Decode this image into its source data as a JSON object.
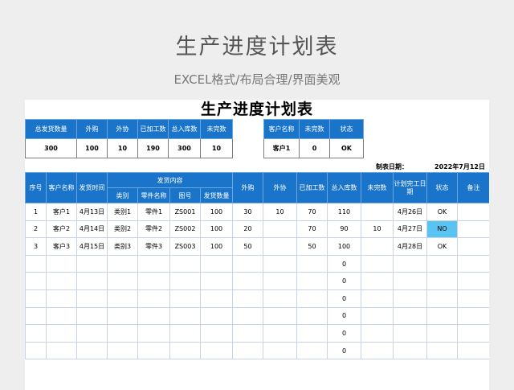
{
  "page": {
    "title": "生产进度计划表",
    "subtitle": "EXCEL格式/布局合理/界面美观"
  },
  "sheet_title": "生产进度计划表",
  "summary_left": {
    "headers": [
      "总发货数量",
      "外购",
      "外协",
      "已加工数",
      "总入库数",
      "未完数"
    ],
    "values": [
      "300",
      "100",
      "10",
      "190",
      "300",
      "10"
    ]
  },
  "summary_right": {
    "headers": [
      "客户名称",
      "未完数",
      "状态"
    ],
    "values": [
      "客户1",
      "0",
      "OK"
    ]
  },
  "date": {
    "label": "制表日期：",
    "value": "2022年7月12日"
  },
  "table": {
    "headers": {
      "seq": "序号",
      "customer": "客户名称",
      "ship_time": "发货时间",
      "ship_content": "发货内容",
      "category": "类别",
      "part_name": "零件名称",
      "drawing_no": "图号",
      "ship_qty": "发货数量",
      "purchase": "外购",
      "outsource": "外协",
      "processed": "已加工数",
      "stock_in": "总入库数",
      "unfinished": "未完数",
      "plan_date": "计划完工日期",
      "status": "状态",
      "note": "备注"
    },
    "rows": [
      [
        "1",
        "客户1",
        "4月13日",
        "类别1",
        "零件1",
        "ZS001",
        "100",
        "30",
        "10",
        "70",
        "110",
        "",
        "4月26日",
        "OK",
        ""
      ],
      [
        "2",
        "客户2",
        "4月14日",
        "类别2",
        "零件2",
        "ZS002",
        "100",
        "20",
        "",
        "70",
        "90",
        "10",
        "4月27日",
        "NO",
        ""
      ],
      [
        "3",
        "客户3",
        "4月15日",
        "类别3",
        "零件3",
        "ZS003",
        "100",
        "50",
        "",
        "50",
        "100",
        "",
        "4月28日",
        "OK",
        ""
      ],
      [
        "",
        "",
        "",
        "",
        "",
        "",
        "",
        "",
        "",
        "",
        "0",
        "",
        "",
        "",
        ""
      ],
      [
        "",
        "",
        "",
        "",
        "",
        "",
        "",
        "",
        "",
        "",
        "0",
        "",
        "",
        "",
        ""
      ],
      [
        "",
        "",
        "",
        "",
        "",
        "",
        "",
        "",
        "",
        "",
        "0",
        "",
        "",
        "",
        ""
      ],
      [
        "",
        "",
        "",
        "",
        "",
        "",
        "",
        "",
        "",
        "",
        "0",
        "",
        "",
        "",
        ""
      ],
      [
        "",
        "",
        "",
        "",
        "",
        "",
        "",
        "",
        "",
        "",
        "0",
        "",
        "",
        "",
        ""
      ],
      [
        "",
        "",
        "",
        "",
        "",
        "",
        "",
        "",
        "",
        "",
        "0",
        "",
        "",
        "",
        ""
      ]
    ]
  }
}
